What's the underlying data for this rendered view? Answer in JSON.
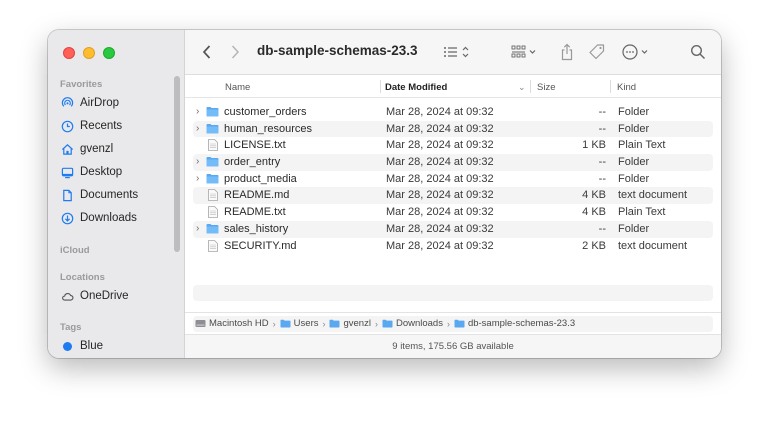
{
  "window": {
    "title": "db-sample-schemas-23.3"
  },
  "sidebar": {
    "favorites_label": "Favorites",
    "favorites": [
      {
        "label": "AirDrop",
        "icon": "airdrop-icon"
      },
      {
        "label": "Recents",
        "icon": "clock-icon"
      },
      {
        "label": "gvenzl",
        "icon": "home-icon"
      },
      {
        "label": "Desktop",
        "icon": "desktop-icon"
      },
      {
        "label": "Documents",
        "icon": "document-icon"
      },
      {
        "label": "Downloads",
        "icon": "download-icon"
      }
    ],
    "icloud_label": "iCloud",
    "locations_label": "Locations",
    "locations": [
      {
        "label": "OneDrive",
        "icon": "cloud-icon"
      }
    ],
    "tags_label": "Tags",
    "tags": [
      {
        "label": "Blue",
        "color": "#1e7cf2"
      }
    ]
  },
  "columns": {
    "name": "Name",
    "date": "Date Modified",
    "size": "Size",
    "kind": "Kind"
  },
  "files": [
    {
      "name": "customer_orders",
      "date": "Mar 28, 2024 at 09:32",
      "size": "--",
      "kind": "Folder",
      "type": "folder"
    },
    {
      "name": "human_resources",
      "date": "Mar 28, 2024 at 09:32",
      "size": "--",
      "kind": "Folder",
      "type": "folder"
    },
    {
      "name": "LICENSE.txt",
      "date": "Mar 28, 2024 at 09:32",
      "size": "1 KB",
      "kind": "Plain Text",
      "type": "file"
    },
    {
      "name": "order_entry",
      "date": "Mar 28, 2024 at 09:32",
      "size": "--",
      "kind": "Folder",
      "type": "folder"
    },
    {
      "name": "product_media",
      "date": "Mar 28, 2024 at 09:32",
      "size": "--",
      "kind": "Folder",
      "type": "folder"
    },
    {
      "name": "README.md",
      "date": "Mar 28, 2024 at 09:32",
      "size": "4 KB",
      "kind": "text document",
      "type": "file"
    },
    {
      "name": "README.txt",
      "date": "Mar 28, 2024 at 09:32",
      "size": "4 KB",
      "kind": "Plain Text",
      "type": "file"
    },
    {
      "name": "sales_history",
      "date": "Mar 28, 2024 at 09:32",
      "size": "--",
      "kind": "Folder",
      "type": "folder"
    },
    {
      "name": "SECURITY.md",
      "date": "Mar 28, 2024 at 09:32",
      "size": "2 KB",
      "kind": "text document",
      "type": "file"
    }
  ],
  "path": [
    "Macintosh HD",
    "Users",
    "gvenzl",
    "Downloads",
    "db-sample-schemas-23.3"
  ],
  "status": "9 items, 175.56 GB available",
  "colors": {
    "accent": "#1e7cf2",
    "folder": "#5aa9f0"
  }
}
